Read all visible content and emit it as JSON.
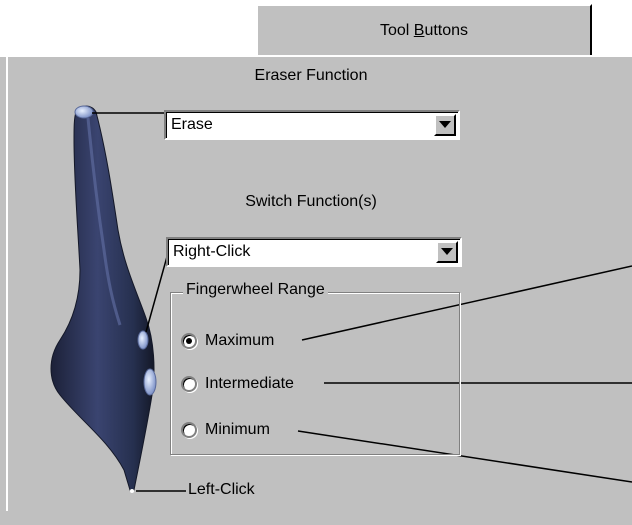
{
  "tabs": [
    {
      "label_before": "Tool ",
      "label_underline": "B",
      "label_after": "uttons"
    }
  ],
  "eraser": {
    "heading": "Eraser Function",
    "selected": "Erase"
  },
  "switch": {
    "heading": "Switch Function(s)",
    "selected": "Right-Click"
  },
  "fingerwheel": {
    "title": "Fingerwheel Range",
    "options": [
      {
        "label": "Maximum",
        "checked": true
      },
      {
        "label": "Intermediate",
        "checked": false
      },
      {
        "label": "Minimum",
        "checked": false
      }
    ]
  },
  "tip": {
    "label": "Left-Click"
  },
  "icons": {
    "dropdown": "chevron-down-icon",
    "pen": "stylus-pen-icon"
  },
  "colors": {
    "dialog_bg": "#c0c0c0",
    "pen_body": "#2f3658"
  }
}
